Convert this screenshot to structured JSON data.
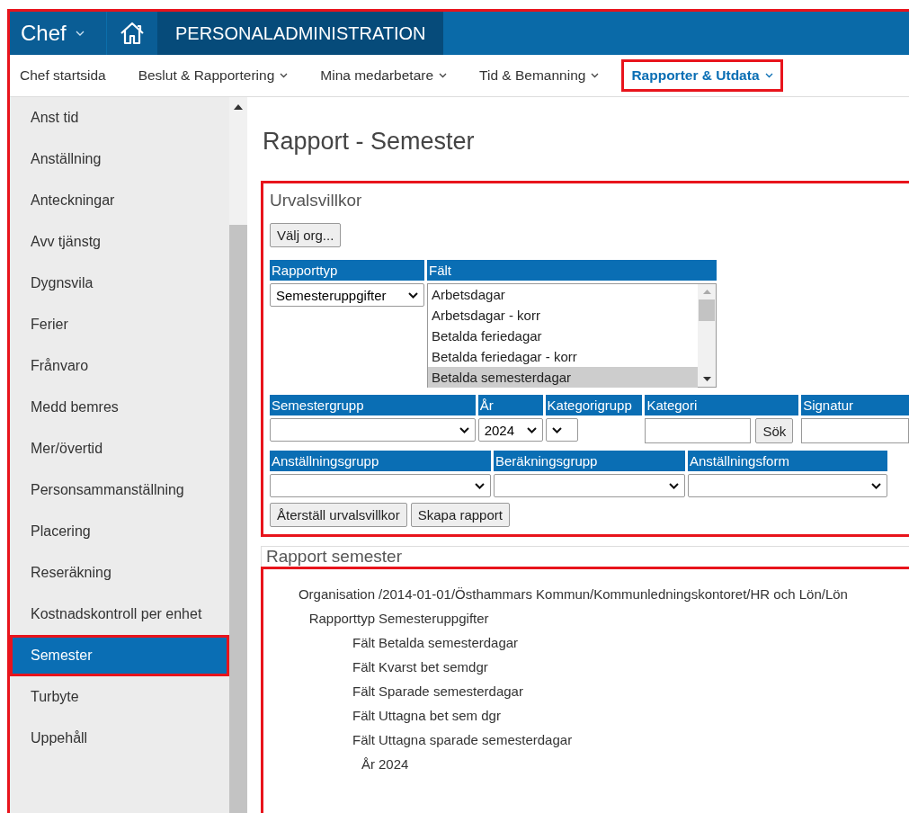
{
  "frame_highlighted": true,
  "app_menu": {
    "label": "Chef"
  },
  "module_title": "PERSONALADMINISTRATION",
  "nav": [
    {
      "label": "Chef startsida",
      "dropdown": false,
      "selected": false,
      "highlighted": false
    },
    {
      "label": "Beslut & Rapportering",
      "dropdown": true,
      "selected": false,
      "highlighted": false
    },
    {
      "label": "Mina medarbetare",
      "dropdown": true,
      "selected": false,
      "highlighted": false
    },
    {
      "label": "Tid & Bemanning",
      "dropdown": true,
      "selected": false,
      "highlighted": false
    },
    {
      "label": "Rapporter & Utdata",
      "dropdown": true,
      "selected": true,
      "highlighted": true
    }
  ],
  "sidebar": {
    "items": [
      {
        "label": "Anst tid",
        "selected": false,
        "highlighted": false
      },
      {
        "label": "Anställning",
        "selected": false,
        "highlighted": false
      },
      {
        "label": "Anteckningar",
        "selected": false,
        "highlighted": false
      },
      {
        "label": "Avv tjänstg",
        "selected": false,
        "highlighted": false
      },
      {
        "label": "Dygnsvila",
        "selected": false,
        "highlighted": false
      },
      {
        "label": "Ferier",
        "selected": false,
        "highlighted": false
      },
      {
        "label": "Frånvaro",
        "selected": false,
        "highlighted": false
      },
      {
        "label": "Medd bemres",
        "selected": false,
        "highlighted": false
      },
      {
        "label": "Mer/övertid",
        "selected": false,
        "highlighted": false
      },
      {
        "label": "Personsammanställning",
        "selected": false,
        "highlighted": false
      },
      {
        "label": "Placering",
        "selected": false,
        "highlighted": false
      },
      {
        "label": "Reseräkning",
        "selected": false,
        "highlighted": false
      },
      {
        "label": "Kostnadskontroll per enhet",
        "selected": false,
        "highlighted": false
      },
      {
        "label": "Semester",
        "selected": true,
        "highlighted": true
      },
      {
        "label": "Turbyte",
        "selected": false,
        "highlighted": false
      },
      {
        "label": "Uppehåll",
        "selected": false,
        "highlighted": false
      }
    ]
  },
  "page_title": "Rapport - Semester",
  "criteria": {
    "title": "Urvalsvillkor",
    "highlighted": true,
    "org_button": "Välj org...",
    "report_type": {
      "label": "Rapporttyp",
      "value": "Semesteruppgifter"
    },
    "fields_list": {
      "label": "Fält",
      "options": [
        {
          "label": "Arbetsdagar",
          "selected": false
        },
        {
          "label": "Arbetsdagar - korr",
          "selected": false
        },
        {
          "label": "Betalda feriedagar",
          "selected": false
        },
        {
          "label": "Betalda feriedagar - korr",
          "selected": false
        },
        {
          "label": "Betalda semesterdagar",
          "selected": true
        }
      ]
    },
    "filter_rows": [
      [
        {
          "label": "Semestergrupp",
          "kind": "select"
        },
        {
          "label": "År",
          "kind": "select",
          "value": "2024"
        },
        {
          "label": "Kategorigrupp",
          "kind": "small_select"
        },
        {
          "label": "Kategori",
          "kind": "search",
          "button": "Sök"
        },
        {
          "label": "Signatur",
          "kind": "input"
        }
      ],
      [
        {
          "label": "Anställningsgrupp",
          "kind": "select"
        },
        {
          "label": "Beräkningsgrupp",
          "kind": "select"
        },
        {
          "label": "Anställningsform",
          "kind": "select"
        }
      ]
    ],
    "buttons": [
      "Återställ urvalsvillkor",
      "Skapa rapport"
    ]
  },
  "result": {
    "title": "Rapport semester",
    "highlighted": true,
    "lines": [
      {
        "label": "Organisation",
        "value": "/2014-01-01/Östhammars Kommun/Kommunledningskontoret/HR och Lön/Lön"
      },
      {
        "label": "Rapporttyp",
        "value": "Semesteruppgifter"
      },
      {
        "label": "Fält",
        "value": "Betalda semesterdagar"
      },
      {
        "label": "Fält",
        "value": "Kvarst bet semdgr"
      },
      {
        "label": "Fält",
        "value": "Sparade semesterdagar"
      },
      {
        "label": "Fält",
        "value": "Uttagna bet sem dgr"
      },
      {
        "label": "Fält",
        "value": "Uttagna sparade semesterdagar"
      },
      {
        "label": "År",
        "value": "2024"
      }
    ]
  }
}
